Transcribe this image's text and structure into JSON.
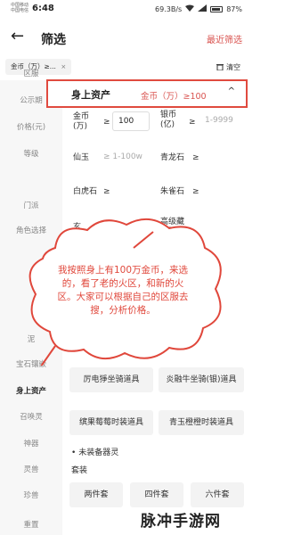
{
  "status": {
    "carrier1": "中国移动",
    "carrier2": "中国电信",
    "time": "6:48",
    "speed": "69.3B/s",
    "battery": "87%"
  },
  "header": {
    "title": "筛选",
    "reset": "最近筛选"
  },
  "filter": {
    "chip": "金币（万）≥...",
    "chip_close": "×",
    "clear": "清空"
  },
  "sidebar": {
    "items": [
      "区服",
      "公示期",
      "价格(元)",
      "等级",
      "门派",
      "角色选择",
      "泥",
      "宝石镶嵌",
      "身上资产",
      "召唤灵",
      "神器",
      "灵兽",
      "珍兽",
      "重置"
    ]
  },
  "group": {
    "title": "身上资产",
    "summary": "金币（万）≥100",
    "caret": "^"
  },
  "fields": {
    "gold_label": "金币\n(万)",
    "gold_op": "≥",
    "gold_value": "100",
    "silver_label": "银币\n(亿)",
    "silver_op": "≥",
    "silver_placeholder": "1-9999",
    "xianyu_label": "仙玉",
    "xianyu_placeholder": "≥ 1-100w",
    "qinglong_label": "青龙石",
    "qinglong_op": "≥",
    "baihu_label": "白虎石",
    "baihu_op": "≥",
    "zhuque_label": "朱雀石",
    "zhuque_op": "≥",
    "xuan_label": "玄",
    "gaoji_label": "高级藏\n宝图"
  },
  "annotation": {
    "text": "我按照身上有100万金币，来选的，看了老的火区，和新的火区。大家可以根据自己的区服去搜，分析价格。"
  },
  "options": {
    "row1": [
      "厉电猙坐骑道具",
      "炎融牛坐骑(银)道具"
    ],
    "row2": [
      "缤果莓莓时装道具",
      "青玉橙橙时装道具"
    ],
    "section": "未装备器灵",
    "section_sub": "套装",
    "row3": [
      "两件套",
      "四件套",
      "六件套"
    ]
  },
  "watermark": "脉冲手游网"
}
